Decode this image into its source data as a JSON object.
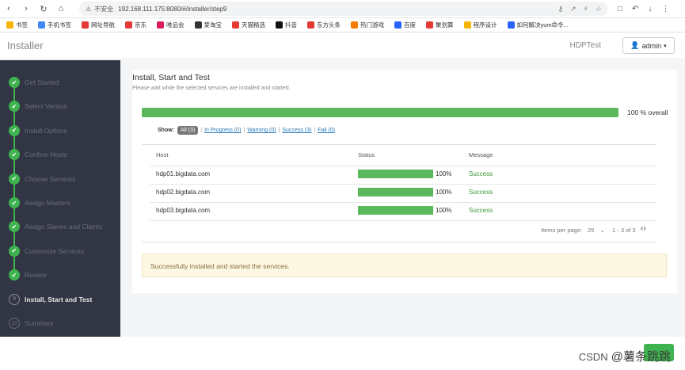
{
  "browser": {
    "insecure_label": "不安全",
    "url": "192.168.111.175:8080/#/installer/step9"
  },
  "bookmarks": [
    {
      "label": "书签",
      "color": "#f4b400"
    },
    {
      "label": "手机书签",
      "color": "#4285f4"
    },
    {
      "label": "网址导航",
      "color": "#e53935"
    },
    {
      "label": "京东",
      "color": "#e53935"
    },
    {
      "label": "唯品会",
      "color": "#d81b60"
    },
    {
      "label": "爱淘宝",
      "color": "#333333"
    },
    {
      "label": "天猫精选",
      "color": "#e53935"
    },
    {
      "label": "抖音",
      "color": "#111111"
    },
    {
      "label": "东方头条",
      "color": "#e53935"
    },
    {
      "label": "热门游戏",
      "color": "#f57c00"
    },
    {
      "label": "百度",
      "color": "#2962ff"
    },
    {
      "label": "聚划算",
      "color": "#e53935"
    },
    {
      "label": "程序设计",
      "color": "#f4b400"
    },
    {
      "label": "如何解决yum命令...",
      "color": "#2962ff"
    }
  ],
  "app": {
    "brand": "Installer",
    "cluster": "HDPTest",
    "user": "admin"
  },
  "steps": [
    {
      "label": "Get Started",
      "state": "done",
      "num": "1"
    },
    {
      "label": "Select Version",
      "state": "done",
      "num": "2"
    },
    {
      "label": "Install Options",
      "state": "done",
      "num": "3"
    },
    {
      "label": "Confirm Hosts",
      "state": "done",
      "num": "4"
    },
    {
      "label": "Choose Services",
      "state": "done",
      "num": "5"
    },
    {
      "label": "Assign Masters",
      "state": "done",
      "num": "6"
    },
    {
      "label": "Assign Slaves and Clients",
      "state": "done",
      "num": "7"
    },
    {
      "label": "Customize Services",
      "state": "done",
      "num": "8"
    },
    {
      "label": "Review",
      "state": "done",
      "num": "9"
    },
    {
      "label": "Install, Start and Test",
      "state": "current",
      "num": "9"
    },
    {
      "label": "Summary",
      "state": "pending",
      "num": "10"
    }
  ],
  "main": {
    "title": "Install, Start and Test",
    "subtitle": "Please wait while the selected services are installed and started.",
    "overall_progress": 100,
    "overall_label": "100 % overall",
    "filters": {
      "show_label": "Show:",
      "all": "All (3)",
      "in_progress": "In Progress (0)",
      "warning": "Warning (0)",
      "success": "Success (3)",
      "fail": "Fail (0)"
    },
    "columns": [
      "Host",
      "Status",
      "Message"
    ],
    "hosts": [
      {
        "host": "hdp01.bigdata.com",
        "progress": 100,
        "percent": "100%",
        "message": "Success"
      },
      {
        "host": "hdp02.bigdata.com",
        "progress": 100,
        "percent": "100%",
        "message": "Success"
      },
      {
        "host": "hdp03.bigdata.com",
        "progress": 100,
        "percent": "100%",
        "message": "Success"
      }
    ],
    "pager": {
      "items_per_page_label": "Items per page:",
      "items_per_page": "25",
      "range": "1 - 3 of 3"
    },
    "notice": "Successfully installed and started the services."
  },
  "footer": {
    "watermark_prefix": "CSDN",
    "watermark": "@薯条跳跳"
  }
}
